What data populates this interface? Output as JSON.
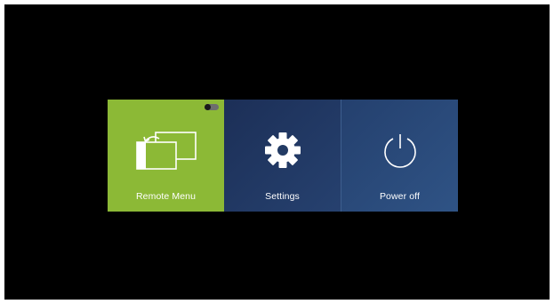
{
  "menu": {
    "tiles": [
      {
        "label": "Remote Menu",
        "icon": "screen-mirror-icon",
        "color": "#8cb936"
      },
      {
        "label": "Settings",
        "icon": "gear-icon",
        "color": "#233a62"
      },
      {
        "label": "Power off",
        "icon": "power-icon",
        "color": "#2b4a78"
      }
    ],
    "toggle_state": "off"
  },
  "colors": {
    "background": "#000000",
    "accent": "#8cb936",
    "tile_blue": "#233a62",
    "text": "#ffffff"
  }
}
